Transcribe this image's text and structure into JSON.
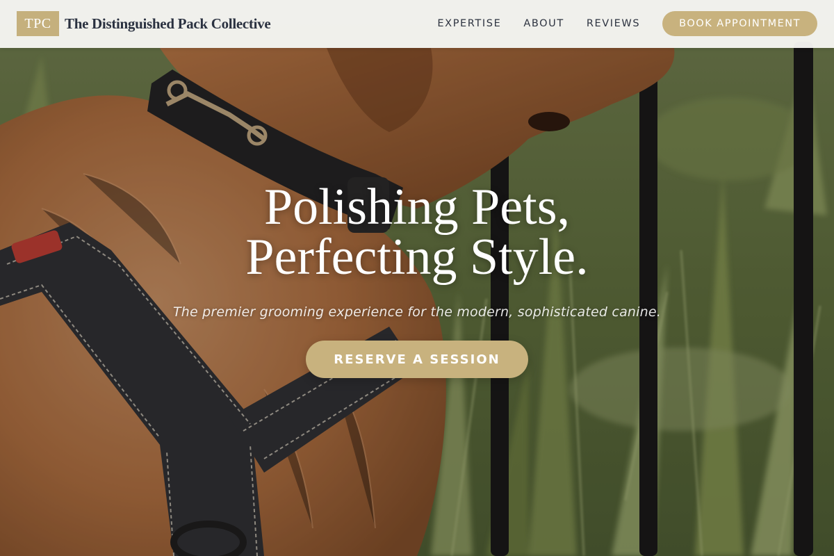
{
  "header": {
    "logo_badge": "TPC",
    "brand_name": "The Distinguished Pack Collective",
    "nav": [
      "EXPERTISE",
      "ABOUT",
      "REVIEWS"
    ],
    "book_label": "BOOK APPOINTMENT"
  },
  "hero": {
    "title_line1": "Polishing Pets,",
    "title_line2": "Perfecting Style.",
    "subtitle": "The premier grooming experience for the modern, sophisticated canine.",
    "cta_label": "RESERVE A SESSION",
    "background": "dog-with-harness-photo"
  },
  "colors": {
    "accent": "#c8b27e",
    "header_bg": "#faf9f6",
    "brand_text": "#2a3140"
  }
}
